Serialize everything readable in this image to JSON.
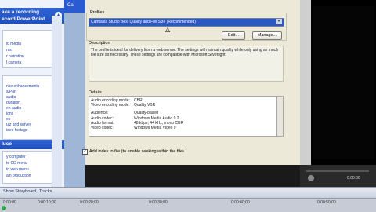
{
  "left_pane": {
    "header1": "ake a recording",
    "header1_line2": "ecord PowerPoint",
    "items_top": [
      "id media",
      "nts",
      "r narration",
      "l camera"
    ],
    "items_mid": [
      "nce enhancements",
      "s/Pan",
      "audio",
      "duration",
      "en audio",
      "ions",
      "es",
      "uiz and survey",
      "ideo footage"
    ],
    "header2": "luce",
    "items_bottom": [
      "y computer",
      "to CD menu",
      "to web menu",
      "ain production"
    ]
  },
  "middle_strip": {
    "label": "Ca"
  },
  "dialog": {
    "profiles_label": "Profiles",
    "profile_selected": "Camtasia Studio Best Quality and File Size (Recommended)",
    "edit_button": "Edit...",
    "manage_button": "Manage...",
    "description_label": "Description",
    "description_text": "The profile is ideal for delivery from a web server. The settings will maintain quality while only using as much file size as necessary. These settings are compatible with Microsoft Silverlight.",
    "details_label": "Details",
    "details": [
      {
        "k": "Audio encoding mode:",
        "v": "CBR"
      },
      {
        "k": "Video encoding mode:",
        "v": "Quality VBR"
      },
      {
        "k": "",
        "v": ""
      },
      {
        "k": "Audience:",
        "v": "Quality-based"
      },
      {
        "k": "Audio codec:",
        "v": "Windows Media Audio 9.2"
      },
      {
        "k": "Audio format:",
        "v": "48 kbps, 44 kHz, mono CBR"
      },
      {
        "k": "Video codec:",
        "v": "Windows Media Video 9"
      }
    ],
    "checkbox_label": "Add index to file (to enable seeking within the file)"
  },
  "timeline": {
    "tab_storyboard": "Show Storyboard",
    "tab_tracks": "Tracks",
    "timecodes": [
      "0:00:00",
      "0:00:10;00",
      "0:00:20;00",
      "0:00:30;00",
      "0:00:40;00",
      "0:00:50;00"
    ],
    "right_time": "0:00:00"
  },
  "colors": {
    "title_blue": "#1f4fbf",
    "selection_blue": "#2b59c3",
    "dialog_bg": "#ece9d8"
  }
}
